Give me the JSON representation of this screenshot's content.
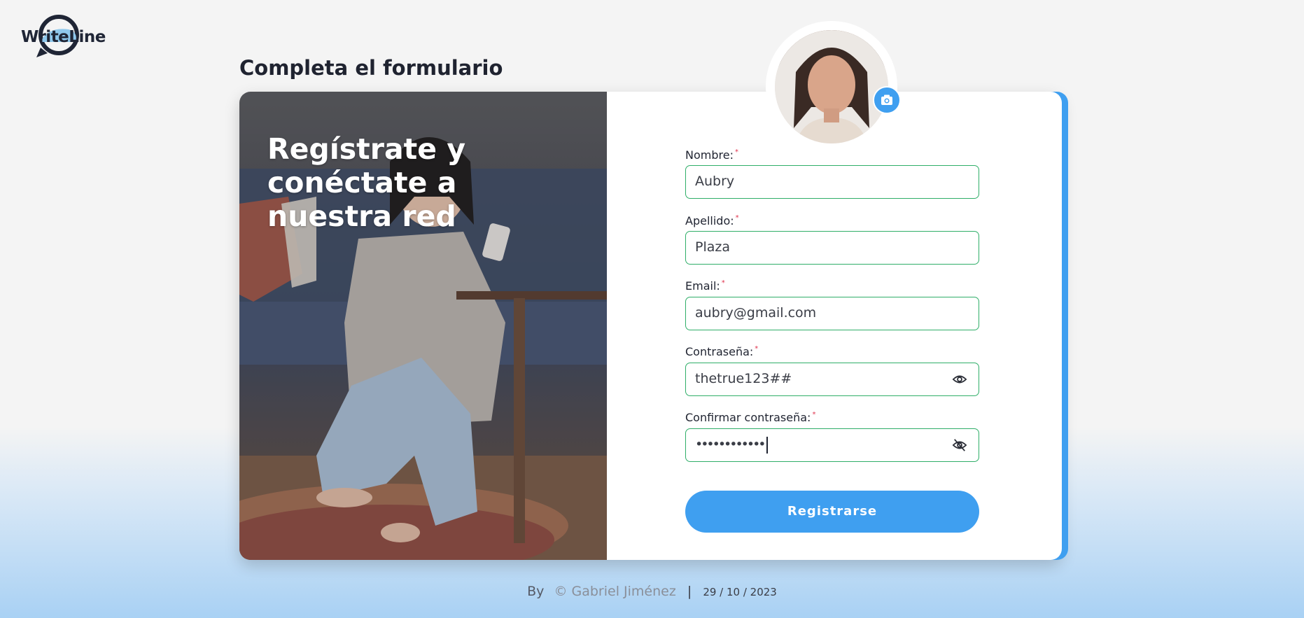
{
  "brand": {
    "logo_text": "WriteLine"
  },
  "page": {
    "title": "Completa el formulario"
  },
  "hero": {
    "headline": "Regístrate y conéctate a nuestra red"
  },
  "form": {
    "fields": [
      {
        "label": "Nombre:",
        "required_mark": "*",
        "value": "Aubry"
      },
      {
        "label": "Apellido:",
        "required_mark": "*",
        "value": "Plaza"
      },
      {
        "label": "Email:",
        "required_mark": "*",
        "value": "aubry@gmail.com"
      },
      {
        "label": "Contraseña:",
        "required_mark": "*",
        "value": "thetrue123##",
        "icon": "eye-icon"
      },
      {
        "label": "Confirmar contraseña:",
        "required_mark": "*",
        "value": "••••••••••••",
        "icon": "eye-slash-icon"
      }
    ],
    "submit_label": "Registrarse"
  },
  "avatar": {
    "upload_icon": "camera-icon"
  },
  "footer": {
    "by": "By",
    "author": "© Gabriel Jiménez",
    "separator": "|",
    "date": "29 / 10 / 2023"
  },
  "colors": {
    "accent": "#3f9ff0",
    "input_border": "#2fae68",
    "required": "#e0334d",
    "title": "#1f2330"
  }
}
